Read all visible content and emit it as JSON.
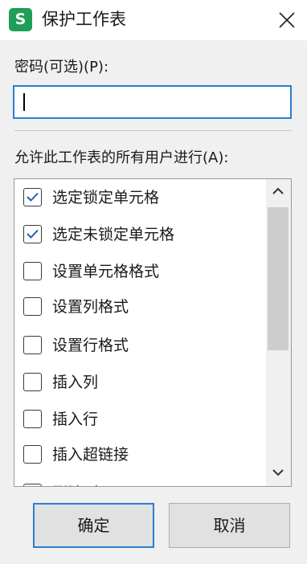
{
  "window": {
    "title": "保护工作表",
    "app_icon_letter": "S"
  },
  "password": {
    "label": "密码(可选)(P):",
    "value": ""
  },
  "permissions": {
    "label": "允许此工作表的所有用户进行(A):",
    "items": [
      {
        "label": "选定锁定单元格",
        "checked": true
      },
      {
        "label": "选定未锁定单元格",
        "checked": true
      },
      {
        "label": "设置单元格格式",
        "checked": false
      },
      {
        "label": "设置列格式",
        "checked": false
      },
      {
        "label": "设置行格式",
        "checked": false
      },
      {
        "label": "插入列",
        "checked": false
      },
      {
        "label": "插入行",
        "checked": false
      },
      {
        "label": "插入超链接",
        "checked": false
      },
      {
        "label": "删除列",
        "checked": false
      }
    ]
  },
  "buttons": {
    "ok": "确定",
    "cancel": "取消"
  },
  "colors": {
    "accent": "#2a7fd0",
    "app_icon": "#1f9e57"
  }
}
